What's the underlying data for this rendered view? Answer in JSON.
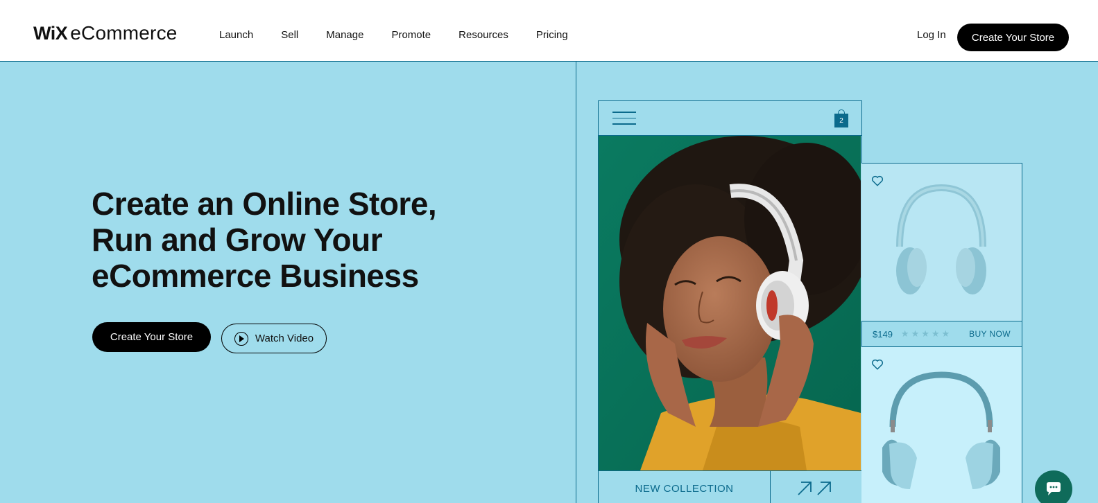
{
  "header": {
    "logo_wix": "WiX",
    "logo_ecommerce": "eCommerce",
    "nav": [
      "Launch",
      "Sell",
      "Manage",
      "Promote",
      "Resources",
      "Pricing"
    ],
    "login": "Log In",
    "cta": "Create Your Store"
  },
  "hero": {
    "title_lines": [
      "Create an Online Store,",
      "Run and Grow Your",
      "eCommerce Business"
    ],
    "cta_primary": "Create Your Store",
    "cta_video": "Watch Video"
  },
  "showcase": {
    "cart_count": "2",
    "new_collection": "NEW COLLECTION",
    "price": "$149",
    "rating_stars": 5,
    "buy_now": "BUY NOW"
  },
  "colors": {
    "background": "#9fdcec",
    "accent": "#0b6a8c",
    "photo_green": "#08795f",
    "button_black": "#000000",
    "chat": "#0f6b5a"
  },
  "icons": [
    "hamburger-icon",
    "shopping-bag-icon",
    "heart-icon",
    "arrow-up-right-icon",
    "play-icon",
    "chat-icon"
  ]
}
